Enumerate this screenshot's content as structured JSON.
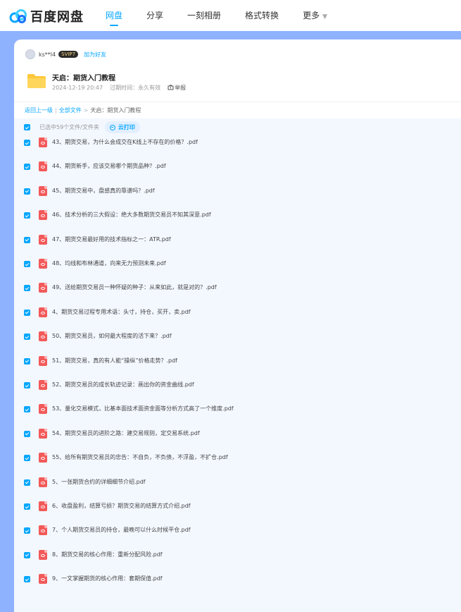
{
  "header": {
    "logo_text": "百度网盘",
    "nav": [
      {
        "label": "网盘",
        "active": true
      },
      {
        "label": "分享",
        "active": false
      },
      {
        "label": "一刻相册",
        "active": false
      },
      {
        "label": "格式转换",
        "active": false
      },
      {
        "label": "更多",
        "active": false
      }
    ]
  },
  "owner": {
    "name": "ks**l4",
    "vip": "SVIP7",
    "add_friend": "加为好友"
  },
  "share": {
    "title": "天启：期货入门教程",
    "date": "2024-12-19 20:47",
    "expire": "过期时间：永久有效",
    "report": "举报"
  },
  "breadcrumb": {
    "back": "返回上一级",
    "all": "全部文件",
    "current": "天启：期货入门教程"
  },
  "selection": {
    "label": "已选中59个文件/文件夹",
    "cloud_print": "云打印"
  },
  "files": [
    "43、期货交易，为什么会成交在K线上不存在的价格？.pdf",
    "44、期货新手，应该交易哪个期货品种？.pdf",
    "45、期货交易中，盘感真的靠谱吗？.pdf",
    "46、技术分析的三大假设：绝大多数期货交易员不知其深意.pdf",
    "47、期货交易最好用的技术指标之一：ATR.pdf",
    "48、均线和布林通道，向来无力预测未来.pdf",
    "49、送给期货交易员一种怀疑的种子：从来如此，就是对的？.pdf",
    "4、期货交易过程专用术语：头寸，持仓，买开，卖.pdf",
    "50、期货交易员，如何最大程度的活下来？.pdf",
    "51、期货交易，真的有人能“操纵”价格走势？.pdf",
    "52、期货交易员的成长轨迹记录：画出你的资金曲线.pdf",
    "53、量化交易模式，比基本面技术面资金面等分析方式高了一个维度.pdf",
    "54、期货交易员的进阶之路：建交易规则，定交易系统.pdf",
    "55、给所有期货交易员的忠告：不自负，不负债，不浮盈，不扩仓.pdf",
    "5、一张期货合约的详细细节介绍.pdf",
    "6、收盘盈利，结算亏损？期货交易的结算方式介绍.pdf",
    "7、个人期货交易员的持仓，最晚可以什么时候平仓.pdf",
    "8、期货交易的核心作用：重新分配风险.pdf",
    "9、一文掌握期货的核心作用：套期保值.pdf"
  ],
  "colors": {
    "accent": "#06a7ff",
    "background": "#8fb2ff",
    "list_bg": "#f3f8ff",
    "pdf_red": "#f25a5a"
  }
}
